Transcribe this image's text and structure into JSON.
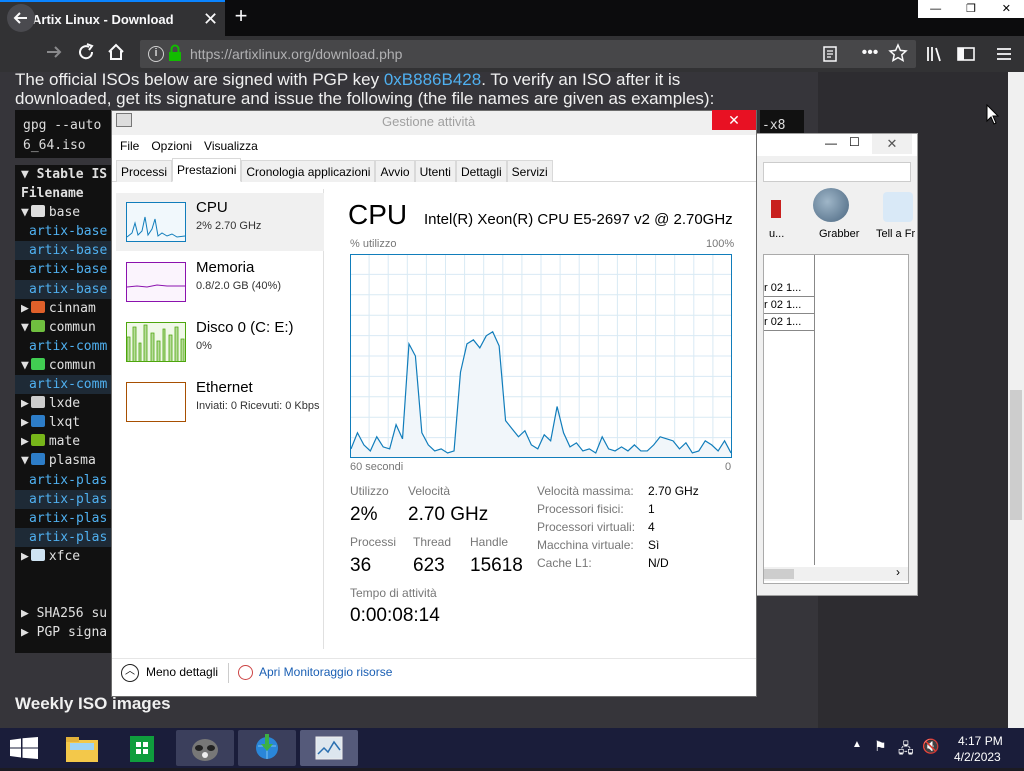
{
  "browser": {
    "tab_title": "Artix Linux - Download",
    "tab_close": "✕",
    "new_tab": "+",
    "url": "https://artixlinux.org/download.php",
    "win_min": "—",
    "win_restore": "❐",
    "win_close": "✕"
  },
  "page": {
    "line1_pre": "The official ISOs below are signed with PGP key ",
    "line1_key": "0xB886B428",
    "line1_post": ". To verify an ISO after it is",
    "line2": "downloaded, get its signature and issue the following (the file names are given as examples):",
    "code_line1": "gpg --auto",
    "code_line2": "6_64.iso",
    "code_right": "-x8",
    "tree": [
      {
        "text": "▼ Stable IS",
        "kind": "bold"
      },
      {
        "text": "Filename",
        "kind": "bold"
      },
      {
        "text": "▼ base",
        "kind": "folder",
        "icon": "#ddd"
      },
      {
        "text": "artix-base",
        "kind": "link"
      },
      {
        "text": "artix-base",
        "kind": "link alt"
      },
      {
        "text": "artix-base",
        "kind": "link"
      },
      {
        "text": "artix-base",
        "kind": "link alt"
      },
      {
        "text": "▶ cinnam",
        "kind": "folder",
        "icon": "#e0602a"
      },
      {
        "text": "▼ commun",
        "kind": "folder",
        "icon": "#6fbf3f"
      },
      {
        "text": "artix-comm",
        "kind": "link"
      },
      {
        "text": "▼ commun",
        "kind": "folder",
        "icon": "#41cd52"
      },
      {
        "text": "artix-comm",
        "kind": "link alt"
      },
      {
        "text": "▶ lxde",
        "kind": "folder",
        "icon": "#cccccc"
      },
      {
        "text": "▶ lxqt",
        "kind": "folder",
        "icon": "#2d7dc8"
      },
      {
        "text": "▶ mate",
        "kind": "folder",
        "icon": "#77b51a"
      },
      {
        "text": "▼ plasma",
        "kind": "folder",
        "icon": "#2d7dc8"
      },
      {
        "text": "artix-plas",
        "kind": "link"
      },
      {
        "text": "artix-plas",
        "kind": "link alt"
      },
      {
        "text": "artix-plas",
        "kind": "link"
      },
      {
        "text": "artix-plas",
        "kind": "link alt"
      },
      {
        "text": "▶ xfce",
        "kind": "folder",
        "icon": "#cfe3f2"
      },
      {
        "text": "",
        "kind": "blank"
      },
      {
        "text": "",
        "kind": "blank"
      },
      {
        "text": "▶ SHA256 su",
        "kind": "folder-plain"
      },
      {
        "text": "▶ PGP signa",
        "kind": "folder-plain"
      }
    ],
    "weekly_heading": "Weekly ISO images"
  },
  "bg_window": {
    "tool_grabber": "Grabber",
    "tool_tell": "Tell a Fr",
    "tool_partial": "u...",
    "rows": [
      "r 02 1...",
      "r 02 1...",
      "r 02 1..."
    ]
  },
  "taskmgr": {
    "title": "Gestione attività",
    "close": "✕",
    "menu": [
      "File",
      "Opzioni",
      "Visualizza"
    ],
    "tabs": [
      "Processi",
      "Prestazioni",
      "Cronologia applicazioni",
      "Avvio",
      "Utenti",
      "Dettagli",
      "Servizi"
    ],
    "active_tab": "Prestazioni",
    "resources": [
      {
        "name": "CPU",
        "value": "2% 2.70 GHz",
        "color": "#117dbb"
      },
      {
        "name": "Memoria",
        "value": "0.8/2.0 GB (40%)",
        "color": "#8b12ae"
      },
      {
        "name": "Disco 0 (C: E:)",
        "value": "0%",
        "color": "#4da60c"
      },
      {
        "name": "Ethernet",
        "value": "Inviati: 0 Ricevuti: 0 Kbps",
        "color": "#a74f01"
      }
    ],
    "cpu_title": "CPU",
    "cpu_model": "Intel(R) Xeon(R) CPU E5-2697 v2 @ 2.70GHz",
    "util_label": "% utilizzo",
    "max_label": "100%",
    "seconds_label": "60 secondi",
    "zero_label": "0",
    "cpu_history": [
      4,
      12,
      6,
      3,
      10,
      5,
      4,
      16,
      9,
      56,
      50,
      12,
      6,
      3,
      4,
      2,
      3,
      42,
      56,
      58,
      54,
      60,
      62,
      55,
      18,
      14,
      10,
      13,
      6,
      4,
      11,
      8,
      25,
      12,
      5,
      7,
      3,
      4,
      2,
      10,
      4,
      3,
      5,
      3,
      6,
      3,
      3,
      6,
      10,
      9,
      8,
      4,
      7,
      2,
      3,
      8,
      6,
      3,
      8,
      2
    ],
    "stats": {
      "util_lbl": "Utilizzo",
      "util_val": "2%",
      "speed_lbl": "Velocità",
      "speed_val": "2.70 GHz",
      "proc_lbl": "Processi",
      "proc_val": "36",
      "thread_lbl": "Thread",
      "thread_val": "623",
      "handle_lbl": "Handle",
      "handle_val": "15618",
      "uptime_lbl": "Tempo di attività",
      "uptime_val": "0:00:08:14"
    },
    "specs": [
      {
        "k": "Velocità massima:",
        "v": "2.70 GHz"
      },
      {
        "k": "Processori fisici:",
        "v": "1"
      },
      {
        "k": "Processori virtuali:",
        "v": "4"
      },
      {
        "k": "Macchina virtuale:",
        "v": "Sì"
      },
      {
        "k": "Cache L1:",
        "v": "N/D"
      }
    ],
    "less_details": "Meno dettagli",
    "open_monitor": "Apri Monitoraggio risorse"
  },
  "taskbar": {
    "time": "4:17 PM",
    "date": "4/2/2023"
  }
}
